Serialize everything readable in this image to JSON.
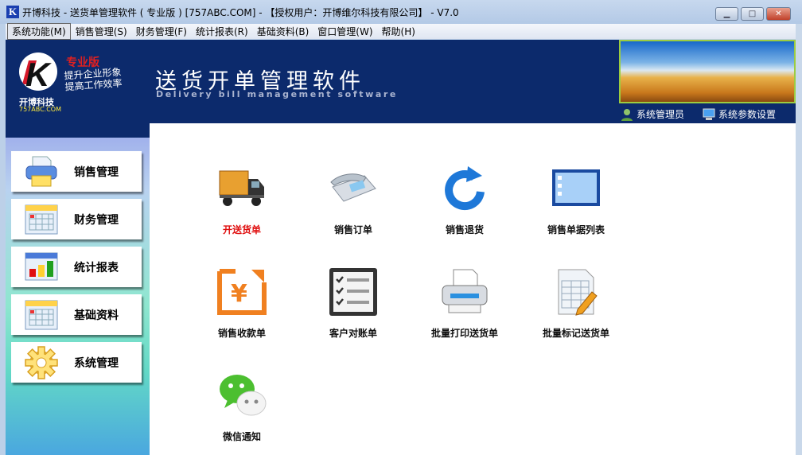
{
  "window": {
    "title": "开博科技 - 送货单管理软件 ( 专业版 ) [757ABC.COM] - 【授权用户：开博维尔科技有限公司】 - V7.0",
    "app_icon": "K",
    "minimize": "▁",
    "maximize": "□",
    "close": "✕"
  },
  "menu": [
    "系统功能(M)",
    "销售管理(S)",
    "财务管理(F)",
    "统计报表(R)",
    "基础资料(B)",
    "窗口管理(W)",
    "帮助(H)"
  ],
  "header": {
    "edition": "专业版",
    "slogan1": "提升企业形象",
    "slogan2": "提高工作效率",
    "company": "开博科技",
    "site": "757ABC.COM",
    "title": "送货开单管理软件",
    "subtitle": "Delivery bill management software",
    "user": "系统管理员",
    "settings": "系统参数设置"
  },
  "sidebar": [
    {
      "label": "销售管理",
      "icon": "printer-icon"
    },
    {
      "label": "财务管理",
      "icon": "calendar-icon"
    },
    {
      "label": "统计报表",
      "icon": "bar-chart-icon"
    },
    {
      "label": "基础资料",
      "icon": "calendar-icon"
    },
    {
      "label": "系统管理",
      "icon": "gear-icon"
    }
  ],
  "tiles": [
    {
      "label": "开送货单",
      "icon": "truck-icon",
      "highlight": true
    },
    {
      "label": "销售订单",
      "icon": "telephone-icon"
    },
    {
      "label": "销售退货",
      "icon": "refresh-icon"
    },
    {
      "label": "销售单据列表",
      "icon": "list-window-icon"
    },
    {
      "label": "销售收款单",
      "icon": "yuan-receipt-icon"
    },
    {
      "label": "客户对账单",
      "icon": "checklist-icon"
    },
    {
      "label": "批量打印送货单",
      "icon": "printer-icon"
    },
    {
      "label": "批量标记送货单",
      "icon": "spreadsheet-edit-icon"
    },
    {
      "label": "微信通知",
      "icon": "wechat-icon"
    }
  ],
  "colors": {
    "header": "#0c2a6c",
    "highlight": "#e01010"
  }
}
